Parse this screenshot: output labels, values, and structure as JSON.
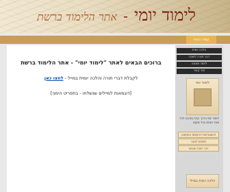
{
  "header": {
    "title_main": "לימוד יומי",
    "separator": "-",
    "title_sub": "אתר הלימוד ברשת"
  },
  "nav": {
    "tabs": [
      {
        "label": "עמוד הבית"
      }
    ]
  },
  "main": {
    "welcome": "ברוכים הבאים לאתר \"לימוד יומי\" - אתר הלימוד ברשת",
    "line2_text": "לקבלת דברי תורה והלכה יומית במייל - ",
    "line2_link": "לחצו כאן",
    "line3": "[דוגמאות למיילים שנשלחו - בתפריט הימני]"
  },
  "sidebar": {
    "buttons": [
      {
        "label": "הלכה יומית"
      },
      {
        "label": "דבר תורה לשבת"
      },
      {
        "label": "לימוד אמונה"
      },
      {
        "label": "צור קשר"
      }
    ],
    "card_title": "לימוד יומי",
    "text": "לימוד יומי בדרך קלה ומהנה לכל אחד ואחת בכל מקום",
    "links": [
      {
        "label": "להצטרפות לרשימת התפוצה"
      },
      {
        "label": "לשלוח לחבר"
      },
      {
        "label": "דבר תורה שבועי"
      }
    ],
    "bottom_card": "הלכה יומית במייל"
  }
}
